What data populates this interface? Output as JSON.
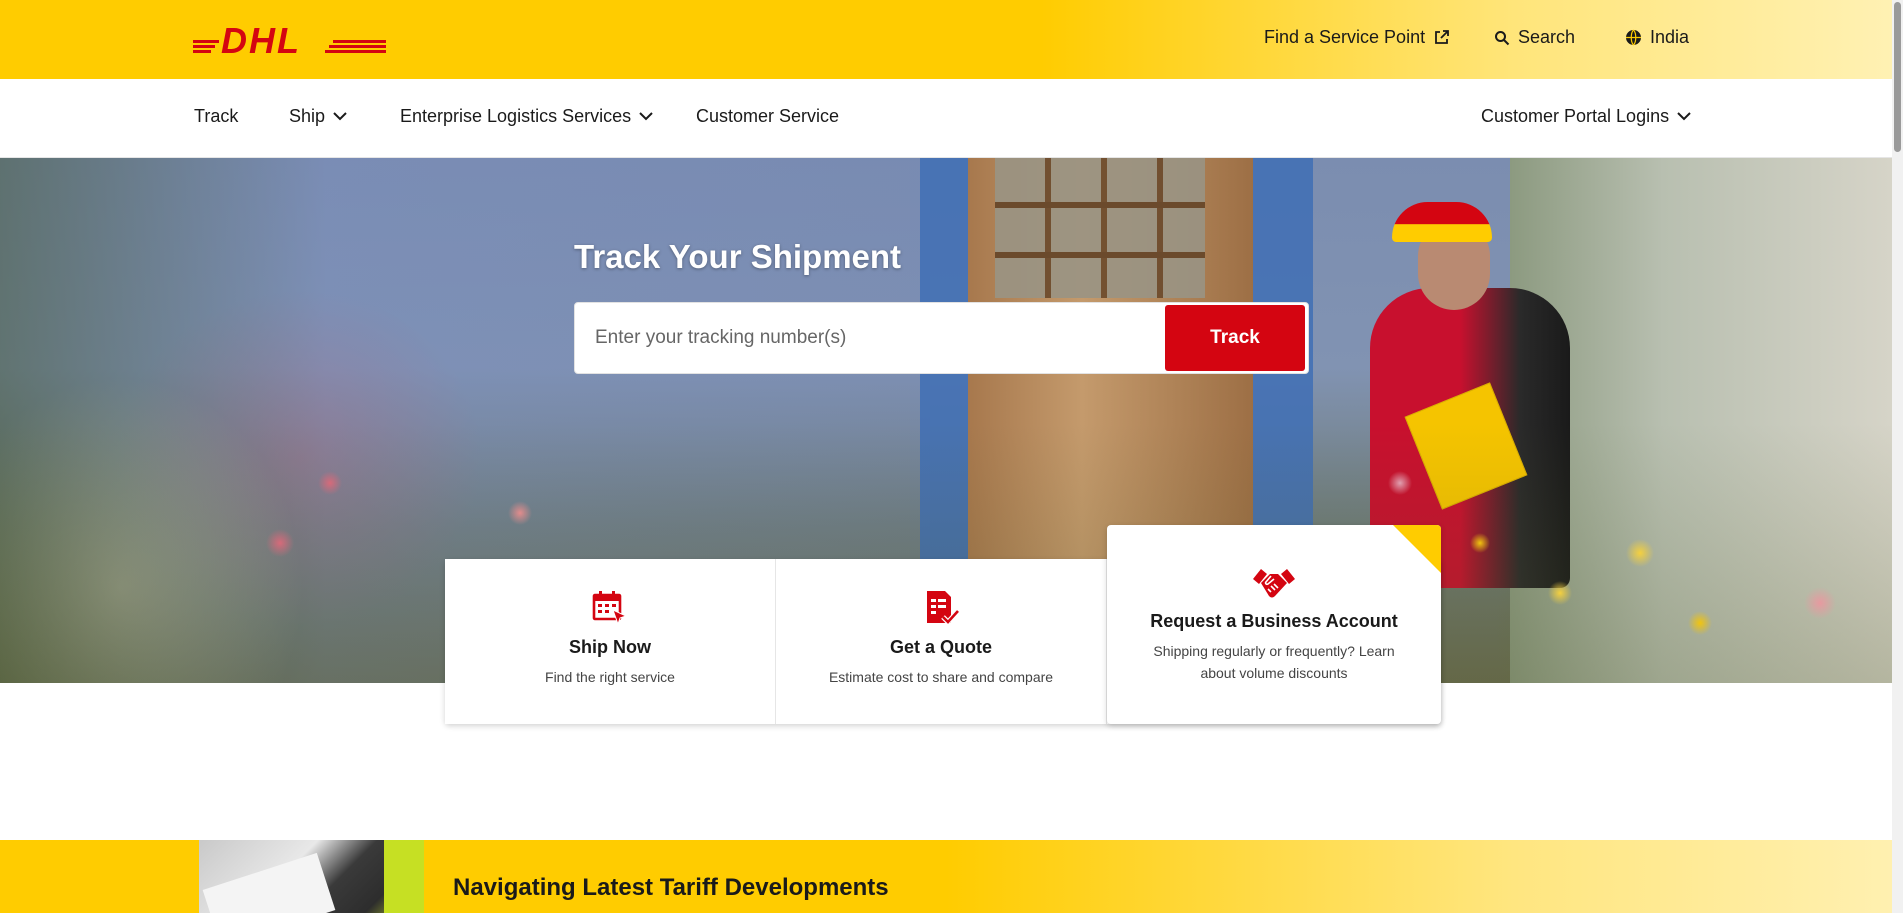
{
  "brand": {
    "logo_text": "DHL",
    "logo_color": "#d40511",
    "yellow": "#ffcc00",
    "red": "#d40511"
  },
  "utility": {
    "service_point": {
      "label": "Find a Service Point",
      "icon": "external-link-icon"
    },
    "search": {
      "label": "Search",
      "icon": "search-icon"
    },
    "country": {
      "label": "India",
      "icon": "globe-icon"
    }
  },
  "nav": {
    "items": [
      {
        "label": "Track"
      },
      {
        "label": "Ship",
        "has_dropdown": true
      },
      {
        "label": "Enterprise Logistics Services",
        "has_dropdown": true
      },
      {
        "label": "Customer Service"
      }
    ],
    "right": {
      "label": "Customer Portal Logins",
      "has_dropdown": true
    }
  },
  "hero": {
    "title": "Track Your Shipment",
    "input_placeholder": "Enter your tracking number(s)",
    "button_label": "Track"
  },
  "cards": [
    {
      "icon": "calendar-cursor-icon",
      "title": "Ship Now",
      "description": "Find the right service"
    },
    {
      "icon": "quote-document-check-icon",
      "title": "Get a Quote",
      "description": "Estimate cost to share and compare"
    },
    {
      "icon": "handshake-icon",
      "title": "Request a Business Account",
      "description": "Shipping regularly or frequently? Learn about volume discounts"
    }
  ],
  "banner": {
    "title": "Navigating Latest Tariff Developments"
  }
}
